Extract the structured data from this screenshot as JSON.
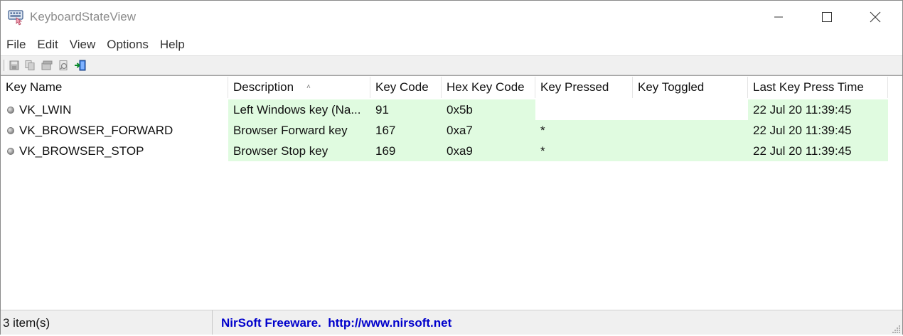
{
  "window": {
    "title": "KeyboardStateView"
  },
  "menu": {
    "items": [
      "File",
      "Edit",
      "View",
      "Options",
      "Help"
    ]
  },
  "toolbar": {
    "buttons": [
      "save-icon",
      "copy-icon",
      "properties-icon",
      "html-report-icon",
      "exit-icon"
    ]
  },
  "table": {
    "columns": [
      "Key Name",
      "Description",
      "Key Code",
      "Hex Key Code",
      "Key Pressed",
      "Key Toggled",
      "Last Key Press Time"
    ],
    "rows": [
      {
        "key_name": "VK_LWIN",
        "description": "Left Windows key (Na...",
        "key_code": "91",
        "hex_key_code": "0x5b",
        "key_pressed": "",
        "key_toggled": "",
        "last_key_press_time": "22 Jul 20 11:39:45"
      },
      {
        "key_name": "VK_BROWSER_FORWARD",
        "description": "Browser Forward key",
        "key_code": "167",
        "hex_key_code": "0xa7",
        "key_pressed": "*",
        "key_toggled": "",
        "last_key_press_time": "22 Jul 20 11:39:45"
      },
      {
        "key_name": "VK_BROWSER_STOP",
        "description": "Browser Stop key",
        "key_code": "169",
        "hex_key_code": "0xa9",
        "key_pressed": "*",
        "key_toggled": "",
        "last_key_press_time": "22 Jul 20 11:39:45"
      }
    ],
    "highlight_color": "#e0fbe0"
  },
  "status": {
    "count": "3 item(s)",
    "credit": "NirSoft Freeware.  http://www.nirsoft.net",
    "credit_color": "#0000cc"
  }
}
